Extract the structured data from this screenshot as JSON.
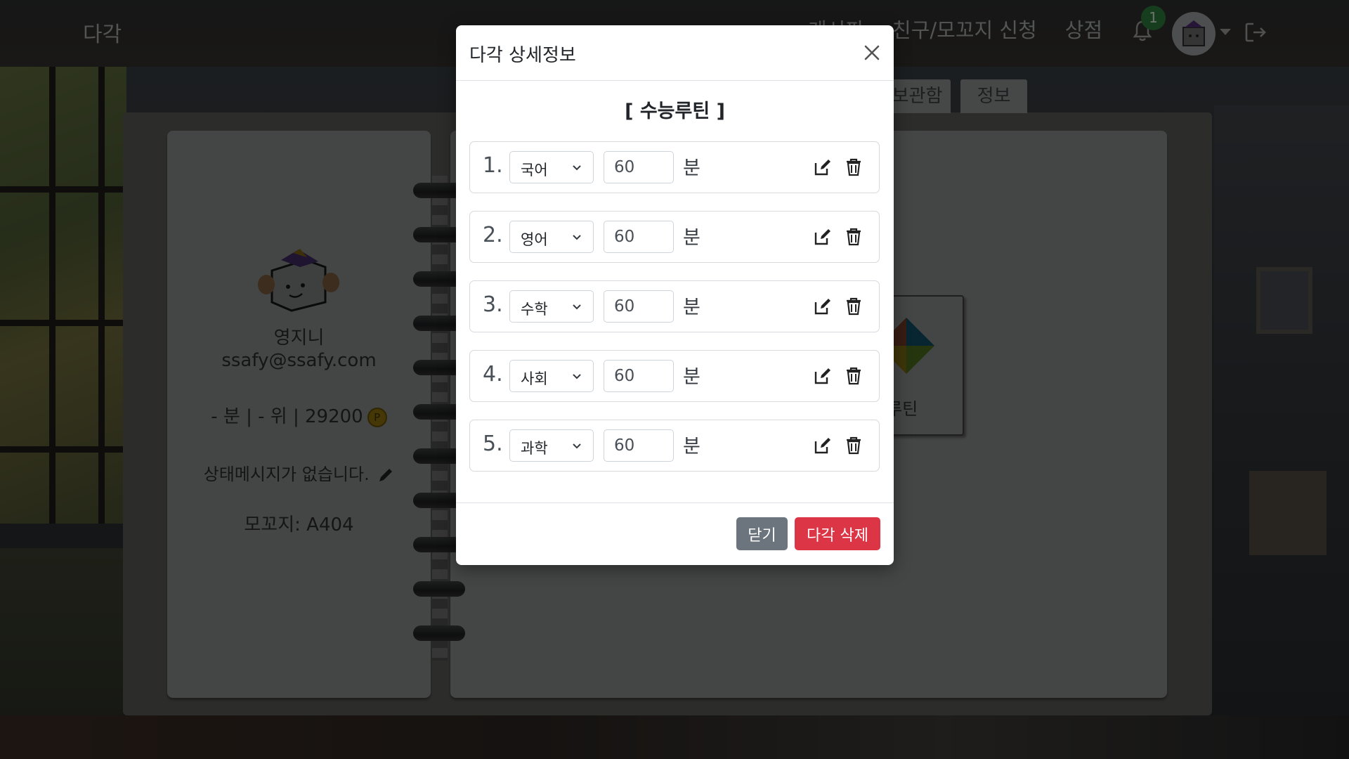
{
  "navbar": {
    "brand": "다각",
    "links": [
      "게시판",
      "친구/모꼬지 신청",
      "상점"
    ],
    "notification_count": "1"
  },
  "tabs": [
    "보관함",
    "정보"
  ],
  "profile": {
    "name": "영지니",
    "email": "ssafy@ssafy.com",
    "stats": "- 분 | - 위 | 29200",
    "coin_symbol": "P",
    "status_message": "상태메시지가 없습니다.",
    "group": "모꼬지: A404"
  },
  "routine_card_label": "후루틴",
  "modal": {
    "title": "다각 상세정보",
    "routine_name": "[ 수능루틴 ]",
    "unit": "분",
    "rows": [
      {
        "num": "1.",
        "subject": "국어",
        "minutes": "60"
      },
      {
        "num": "2.",
        "subject": "영어",
        "minutes": "60"
      },
      {
        "num": "3.",
        "subject": "수학",
        "minutes": "60"
      },
      {
        "num": "4.",
        "subject": "사회",
        "minutes": "60"
      },
      {
        "num": "5.",
        "subject": "과학",
        "minutes": "60"
      }
    ],
    "close_label": "닫기",
    "delete_label": "다각 삭제"
  },
  "colors": {
    "overlay": "#000000",
    "btn_secondary": "#6c757d",
    "btn_danger": "#dc3545",
    "badge": "#2d7a3a"
  },
  "icons": [
    "bell-icon",
    "logout-icon",
    "close-icon",
    "chevron-down-icon",
    "edit-icon",
    "trash-icon",
    "pencil-icon",
    "coin-icon"
  ]
}
